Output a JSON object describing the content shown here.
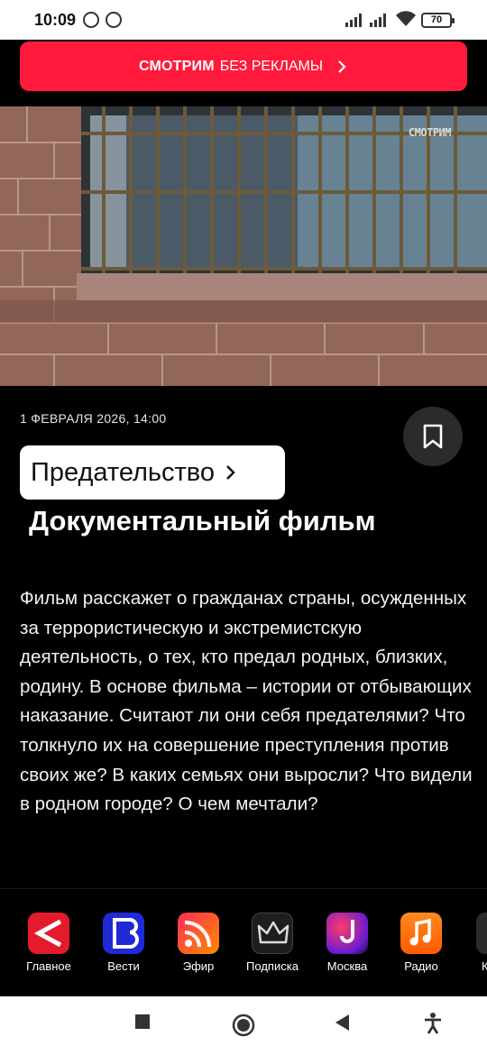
{
  "status_bar": {
    "time": "10:09",
    "battery": "70"
  },
  "promo": {
    "brand": "СМОТРИМ",
    "text": "БЕЗ РЕКЛАМЫ"
  },
  "hero": {
    "watermark": "СМОТРИМ"
  },
  "article": {
    "date": "1 ФЕВРАЛЯ 2026, 14:00",
    "title": "Предательство",
    "subtitle": "Документальный фильм",
    "description": "Фильм расскажет о гражданах страны, осужденных за террористическую и экстремистскую деятельность, о тех, кто предал родных, близких, родину. В основе фильма – истории от отбывающих наказание. Считают ли они себя предателями? Что толкнуло их на совершение преступления против своих же? В каких семьях они выросли? Что видели в родном городе? О чем мечтали?"
  },
  "nav": {
    "items": [
      {
        "label": "Главное",
        "icon": "smotrim-main-icon"
      },
      {
        "label": "Вести",
        "icon": "vesti-icon"
      },
      {
        "label": "Эфир",
        "icon": "broadcast-icon"
      },
      {
        "label": "Подписка",
        "icon": "crown-icon"
      },
      {
        "label": "Москва",
        "icon": "moscow-icon"
      },
      {
        "label": "Радио",
        "icon": "music-note-icon"
      },
      {
        "label": "К",
        "icon": "more-icon"
      }
    ]
  },
  "colors": {
    "accent": "#ff1a3b",
    "background": "#000000"
  }
}
